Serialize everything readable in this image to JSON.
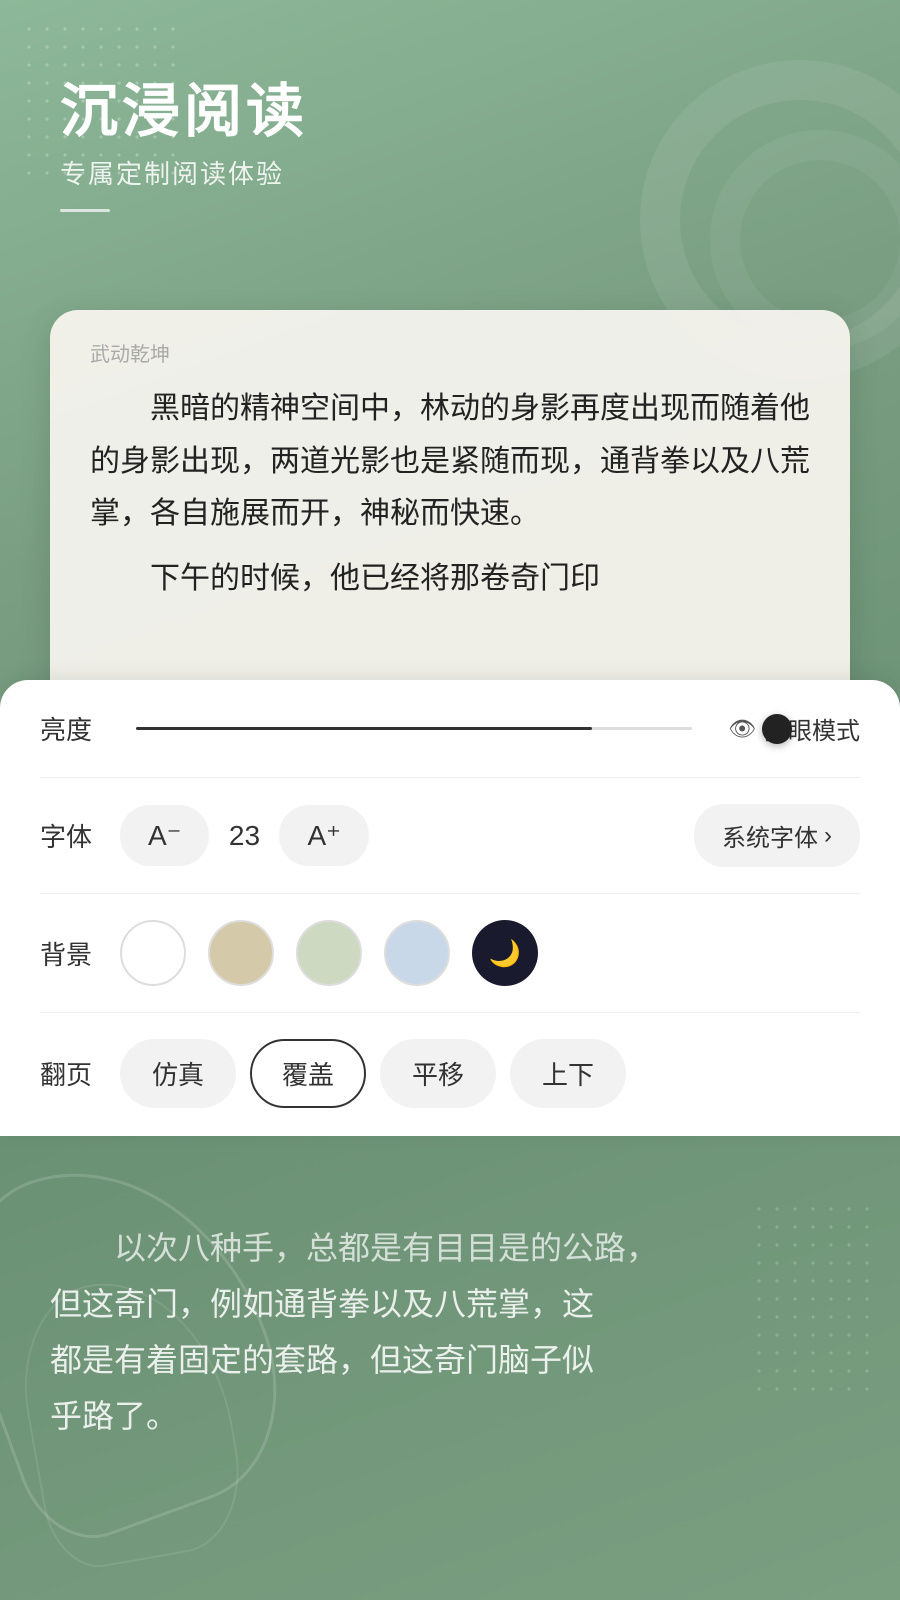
{
  "app": {
    "background_color": "#7a9e80"
  },
  "header": {
    "title": "沉浸阅读",
    "subtitle": "专属定制阅读体验"
  },
  "reading_card": {
    "book_title": "武动乾坤",
    "paragraph1": "黑暗的精神空间中，林动的身影再度出现而随着他的身影出现，两道光影也是紧随而现，通背拳以及八荒掌，各自施展而开，神秘而快速。",
    "paragraph2": "下午的时候，他已经将那卷奇门印"
  },
  "controls": {
    "brightness_label": "亮度",
    "brightness_value": 82,
    "eye_mode_label": "护眼模式",
    "font_label": "字体",
    "font_decrease_label": "A⁻",
    "font_size": "23",
    "font_increase_label": "A⁺",
    "font_type_label": "系统字体",
    "background_label": "背景",
    "page_label": "翻页",
    "page_options": [
      "仿真",
      "覆盖",
      "平移",
      "上下"
    ],
    "page_active": "覆盖"
  },
  "bottom_text": {
    "line1": "以次八种手，总都是有目目是的公路，",
    "line2": "但这奇门，例如通背拳以及八荒掌，这",
    "line3": "都是有着固定的套路，但这奇门脑子似",
    "line4": "乎路了。"
  }
}
